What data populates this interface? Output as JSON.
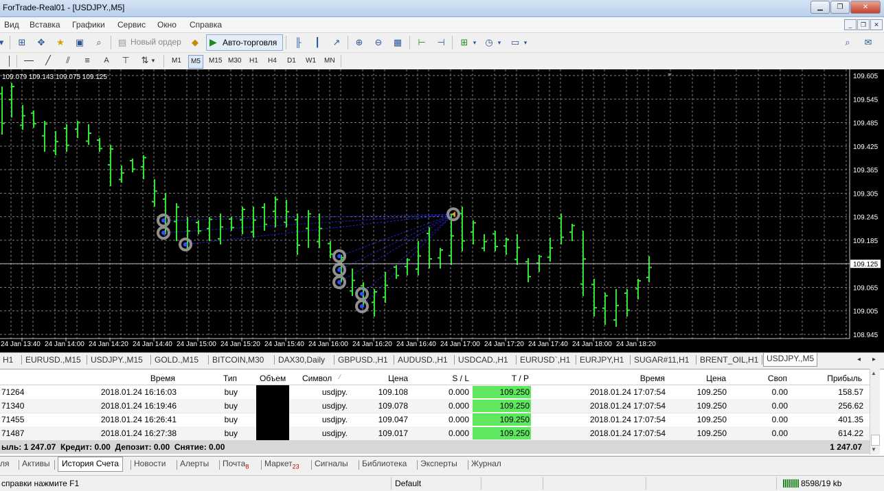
{
  "window": {
    "title": "ForTrade-Real01 - [USDJPY.,M5]"
  },
  "menu": [
    "Вид",
    "Вставка",
    "Графики",
    "Сервис",
    "Окно",
    "Справка"
  ],
  "toolbar": {
    "new_order": "Новый ордер",
    "auto_trading": "Авто-торговля"
  },
  "timeframes": [
    "M1",
    "M5",
    "M15",
    "M30",
    "H1",
    "H4",
    "D1",
    "W1",
    "MN"
  ],
  "timeframe_active": "M5",
  "chart": {
    "ohlc_readout": "109.079 109.143 109.075 109.125",
    "current_price_label": "109.125",
    "price_labels": [
      "109.605",
      "109.545",
      "109.485",
      "109.425",
      "109.365",
      "109.305",
      "109.245",
      "109.185",
      "109.125",
      "109.065",
      "109.005",
      "108.945"
    ],
    "time_labels": [
      "24 Jan 13:40",
      "24 Jan 14:00",
      "24 Jan 14:20",
      "24 Jan 14:40",
      "24 Jan 15:00",
      "24 Jan 15:20",
      "24 Jan 15:40",
      "24 Jan 16:00",
      "24 Jan 16:20",
      "24 Jan 16:40",
      "24 Jan 17:00",
      "24 Jan 17:20",
      "24 Jan 17:40",
      "24 Jan 18:00",
      "24 Jan 18:20"
    ],
    "colors": {
      "background": "#000000",
      "bars": "#32e632",
      "grid": "#808080",
      "trade_lines": "#2020c8"
    }
  },
  "chart_tabs": [
    "H1",
    "EURUSD.,M15",
    "USDJPY.,M15",
    "GOLD.,M15",
    "BITCOIN,M30",
    "DAX30,Daily",
    "GBPUSD.,H1",
    "AUDUSD.,H1",
    "USDCAD.,H1",
    "EURUSD`,H1",
    "EURJPY,H1",
    "SUGAR#11,H1",
    "BRENT_OIL,H1",
    "USDJPY.,M5"
  ],
  "chart_tab_active": "USDJPY.,M5",
  "history": {
    "headers": {
      "open_time": "Время",
      "type": "Тип",
      "volume": "Объем",
      "symbol": "Символ",
      "price": "Цена",
      "sl": "S / L",
      "tp": "T / P",
      "close_time": "Время",
      "close_price": "Цена",
      "swap": "Своп",
      "profit": "Прибыль"
    },
    "rows": [
      {
        "ticket": "71264",
        "open_time": "2018.01.24 16:16:03",
        "type": "buy",
        "symbol": "usdjpy.",
        "price": "109.108",
        "sl": "0.000",
        "tp": "109.250",
        "close_time": "2018.01.24 17:07:54",
        "close_price": "109.250",
        "swap": "0.00",
        "profit": "158.57"
      },
      {
        "ticket": "71340",
        "open_time": "2018.01.24 16:19:46",
        "type": "buy",
        "symbol": "usdjpy.",
        "price": "109.078",
        "sl": "0.000",
        "tp": "109.250",
        "close_time": "2018.01.24 17:07:54",
        "close_price": "109.250",
        "swap": "0.00",
        "profit": "256.62"
      },
      {
        "ticket": "71455",
        "open_time": "2018.01.24 16:26:41",
        "type": "buy",
        "symbol": "usdjpy.",
        "price": "109.047",
        "sl": "0.000",
        "tp": "109.250",
        "close_time": "2018.01.24 17:07:54",
        "close_price": "109.250",
        "swap": "0.00",
        "profit": "401.35"
      },
      {
        "ticket": "71487",
        "open_time": "2018.01.24 16:27:38",
        "type": "buy",
        "symbol": "usdjpy.",
        "price": "109.017",
        "sl": "0.000",
        "tp": "109.250",
        "close_time": "2018.01.24 17:07:54",
        "close_price": "109.250",
        "swap": "0.00",
        "profit": "614.22"
      }
    ],
    "summary": "ыль: 1 247.07  Кредит: 0.00  Депозит: 0.00  Снятие: 0.00",
    "summary_total": "1 247.07"
  },
  "terminal_tabs": [
    {
      "label": "ля"
    },
    {
      "label": "Активы"
    },
    {
      "label": "История Счета"
    },
    {
      "label": "Новости"
    },
    {
      "label": "Алерты"
    },
    {
      "label": "Почта",
      "badge": "8"
    },
    {
      "label": "Маркет",
      "badge": "23"
    },
    {
      "label": "Сигналы"
    },
    {
      "label": "Библиотека"
    },
    {
      "label": "Эксперты"
    },
    {
      "label": "Журнал"
    }
  ],
  "terminal_tab_active": "История Счета",
  "status": {
    "help": "справки нажмите F1",
    "profile": "Default",
    "traffic": "8598/19 kb"
  }
}
